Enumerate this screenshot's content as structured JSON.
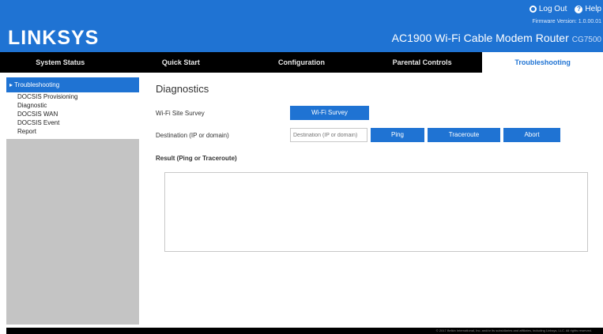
{
  "header": {
    "brand": "LINKSYS",
    "logout_label": "Log Out",
    "help_label": "Help",
    "firmware_text": "Firmware Version: 1.0.00.01",
    "model_name": "AC1900 Wi-Fi Cable Modem Router",
    "model_id": "CG7500",
    "bg_color": "#1f73d3"
  },
  "nav": {
    "tabs": [
      {
        "label": "System Status"
      },
      {
        "label": "Quick Start"
      },
      {
        "label": "Configuration"
      },
      {
        "label": "Parental Controls"
      },
      {
        "label": "Troubleshooting"
      }
    ],
    "active": "Troubleshooting"
  },
  "sidebar": {
    "section": "Troubleshooting",
    "items": [
      {
        "label": "DOCSIS Provisioning"
      },
      {
        "label": "Diagnostic"
      },
      {
        "label": "DOCSIS WAN"
      },
      {
        "label": "DOCSIS Event"
      },
      {
        "label": "Report"
      }
    ]
  },
  "main": {
    "title": "Diagnostics",
    "wifi_survey_label": "Wi-Fi Site Survey",
    "wifi_survey_button": "Wi-Fi Survey",
    "destination_label": "Destination (IP or domain)",
    "destination_placeholder": "Destination (IP or domain)",
    "destination_value": "",
    "ping_button": "Ping",
    "traceroute_button": "Traceroute",
    "abort_button": "Abort",
    "result_label": "Result (Ping or Traceroute)",
    "result_value": ""
  },
  "footer": {
    "text": "© 2017 Belkin International, Inc. and/or its subsidiaries and affiliates, including Linksys, LLC. All rights reserved."
  }
}
